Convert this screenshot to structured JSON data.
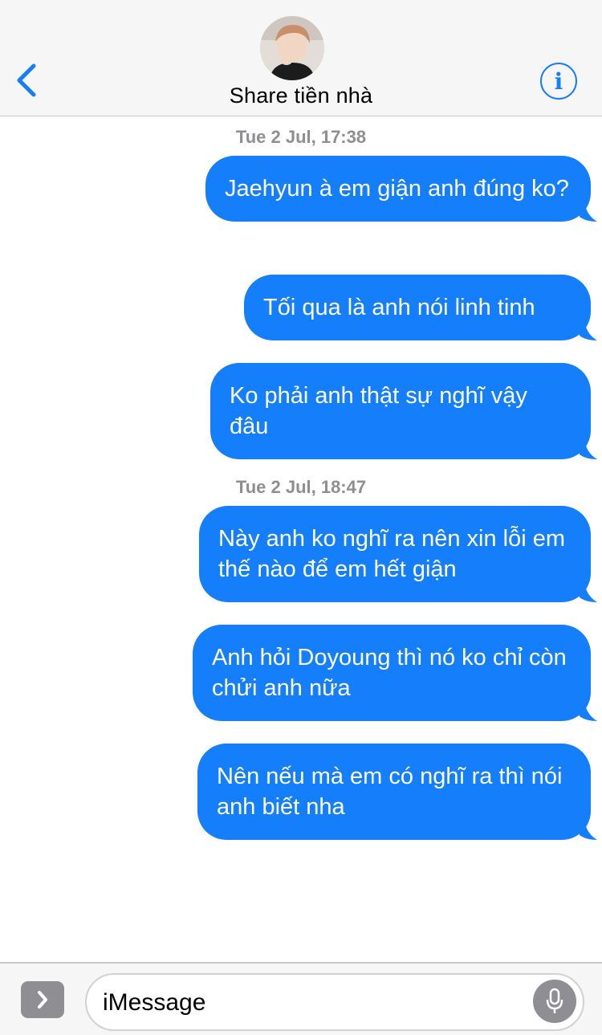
{
  "header": {
    "contact_name": "Share tiền nhà",
    "info_label": "i",
    "accent_color": "#147efb"
  },
  "thread": {
    "groups": [
      {
        "timestamp": "Tue 2 Jul, 17:38",
        "messages": [
          "Jaehyun à em giận anh đúng ko?",
          "Tối qua là anh nói linh tinh",
          "Ko phải anh thật sự nghĩ vậy đâu"
        ]
      },
      {
        "timestamp": "Tue 2 Jul, 18:47",
        "messages": [
          "Này anh ko nghĩ ra nên xin lỗi em thế nào để em hết giận",
          "Anh hỏi Doyoung thì nó ko chỉ còn chửi anh nữa",
          "Nên nếu mà em có nghĩ ra thì nói anh biết nha"
        ]
      }
    ],
    "bubble_color": "#147efb"
  },
  "composer": {
    "placeholder": "iMessage",
    "apps_icon": "chevron-right-icon",
    "mic_icon": "microphone-icon"
  }
}
